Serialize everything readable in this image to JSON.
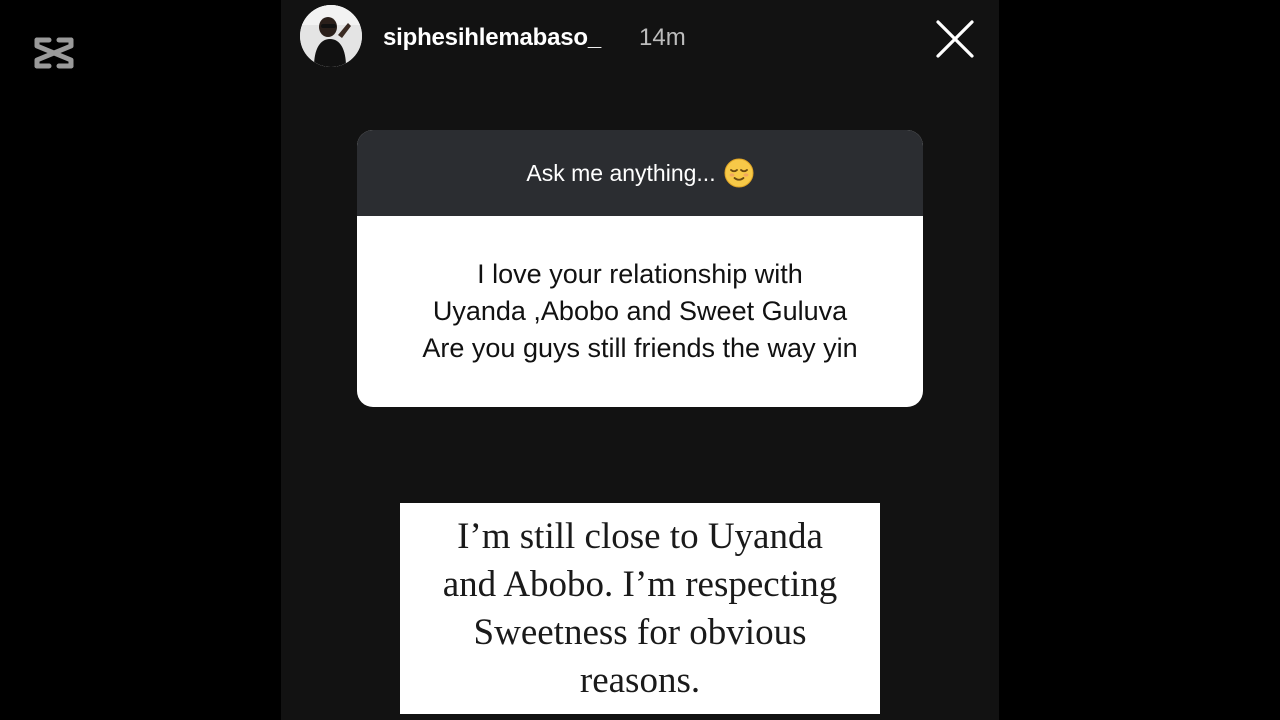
{
  "watermark": {
    "icon": "capcut-logo-icon"
  },
  "story": {
    "author": {
      "username": "siphesihlemabaso_",
      "time_ago": "14m",
      "avatar_icon": "avatar-photo"
    },
    "close_icon": "close-icon",
    "question_sticker": {
      "prompt": "Ask me anything...",
      "prompt_emoji": "relieved-face-emoji",
      "question_lines": [
        "I love your relationship with",
        "Uyanda ,Abobo and Sweet Guluva",
        "Are you guys still friends the way yin"
      ]
    },
    "answer": {
      "lines": [
        "I’m still close to Uyanda",
        "and Abobo. I’m respecting",
        "Sweetness for obvious",
        "reasons."
      ]
    }
  },
  "colors": {
    "page_background": "#000000",
    "story_background": "#121212",
    "sticker_header": "#2b2d31",
    "card_background": "#ffffff",
    "timestamp": "#bdbdbd"
  }
}
